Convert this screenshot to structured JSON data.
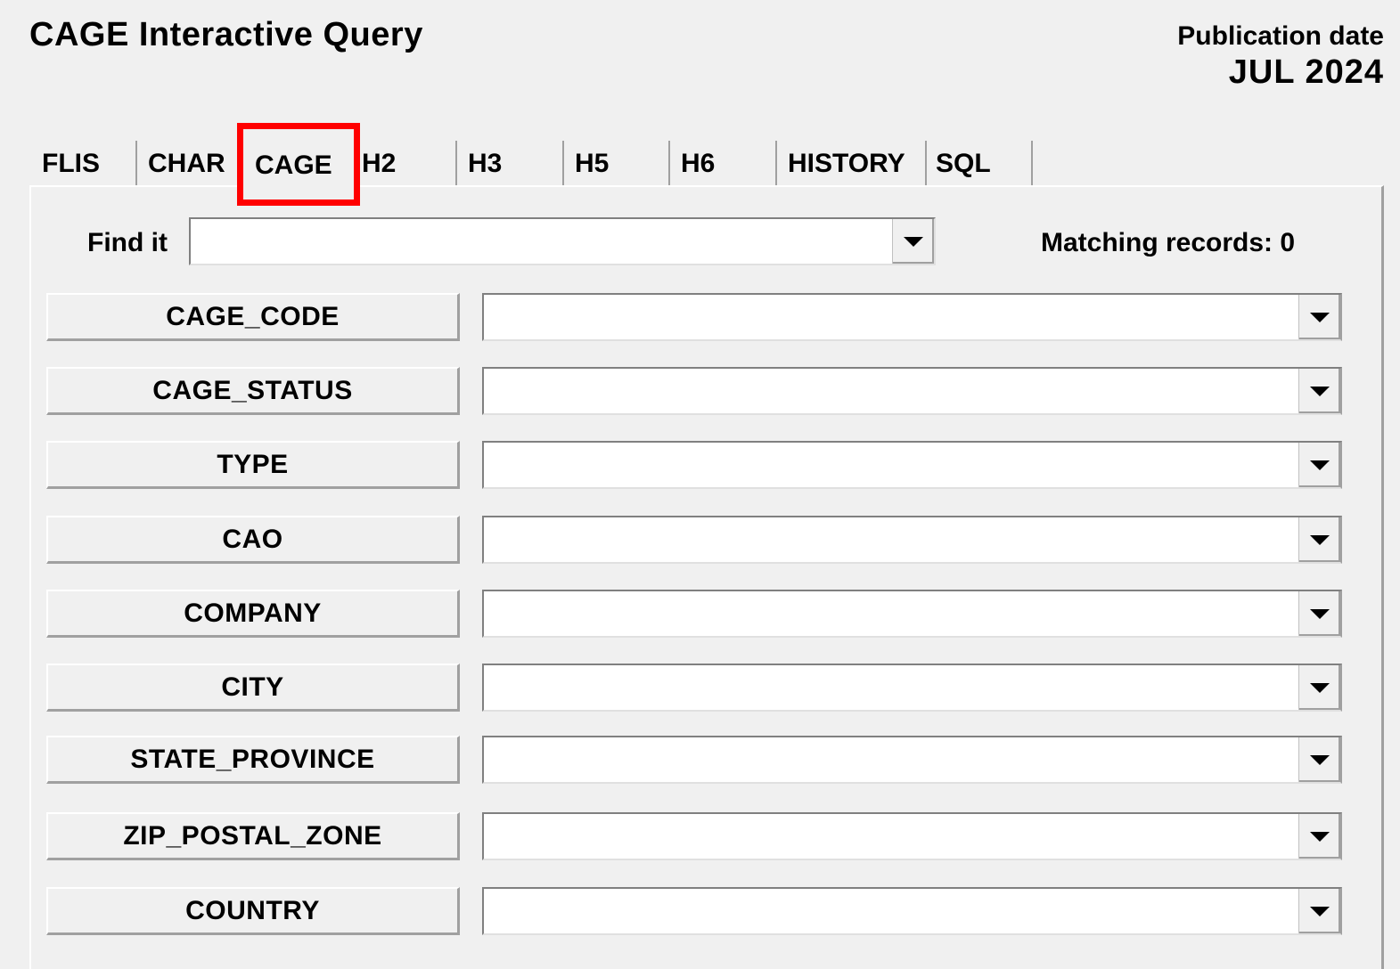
{
  "header": {
    "title": "CAGE Interactive Query",
    "publication_label": "Publication date",
    "publication_value": "JUL 2024"
  },
  "tabs": [
    {
      "label": "FLIS",
      "active": false
    },
    {
      "label": "CHAR",
      "active": false
    },
    {
      "label": "CAGE",
      "active": true
    },
    {
      "label": "H2",
      "active": false
    },
    {
      "label": "H3",
      "active": false
    },
    {
      "label": "H5",
      "active": false
    },
    {
      "label": "H6",
      "active": false
    },
    {
      "label": "HISTORY",
      "active": false
    },
    {
      "label": "SQL",
      "active": false
    }
  ],
  "find": {
    "label": "Find it",
    "value": "",
    "dropdown_icon": "chevron-down-icon"
  },
  "matching_records": "Matching records: 0",
  "fields": [
    {
      "label": "CAGE_CODE",
      "value": ""
    },
    {
      "label": "CAGE_STATUS",
      "value": ""
    },
    {
      "label": "TYPE",
      "value": ""
    },
    {
      "label": "CAO",
      "value": ""
    },
    {
      "label": "COMPANY",
      "value": ""
    },
    {
      "label": "CITY",
      "value": ""
    },
    {
      "label": "STATE_PROVINCE",
      "value": ""
    },
    {
      "label": "ZIP_POSTAL_ZONE",
      "value": ""
    },
    {
      "label": "COUNTRY",
      "value": ""
    }
  ],
  "colors": {
    "background": "#f0f0f0",
    "highlight": "#ff0000"
  }
}
